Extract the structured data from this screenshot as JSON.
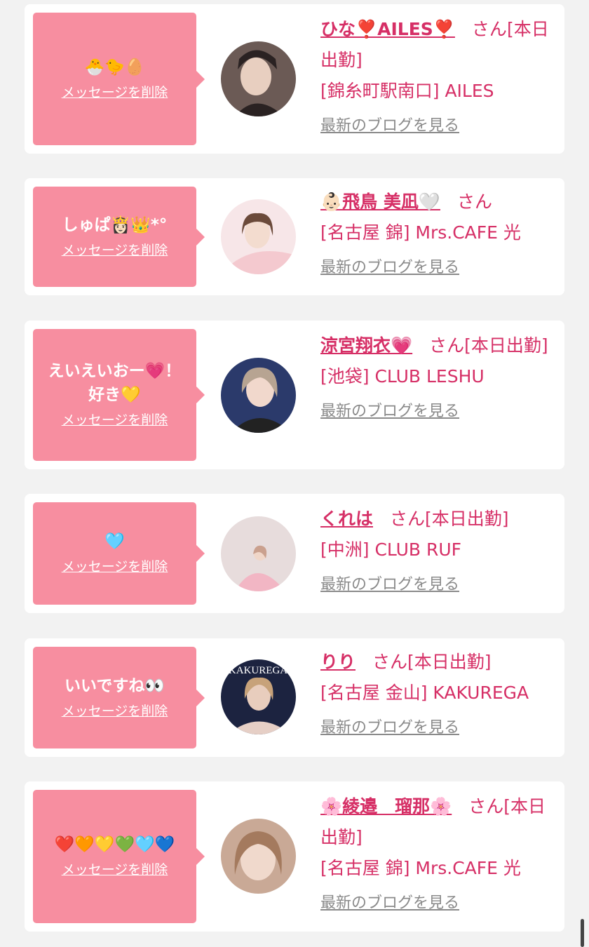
{
  "cards": [
    {
      "message": "🐣🐤🥚",
      "delete_label": "メッセージを削除",
      "name": "ひな❣️AILES❣️",
      "honorific": "さん",
      "status": "[本日出勤]",
      "shop": "[錦糸町駅南口] AILES",
      "blog_label": "最新のブログを見る",
      "avatar_colors": [
        "#6b5a55",
        "#e8cfc0",
        "#2a2222"
      ]
    },
    {
      "message": "しゅぱ👸🏻👑*°",
      "delete_label": "メッセージを削除",
      "name": "👶🏻飛鳥 美凪🤍",
      "honorific": "さん",
      "status": "",
      "shop": "[名古屋 錦] Mrs.CAFE 光",
      "blog_label": "最新のブログを見る",
      "avatar_colors": [
        "#f7e6e8",
        "#f4c9cf",
        "#6b4a3a"
      ]
    },
    {
      "message": "えいえいおー💗！\n好き💛",
      "delete_label": "メッセージを削除",
      "name": "涼宮翔衣💗",
      "honorific": "さん",
      "status": "[本日出勤]",
      "shop": "[池袋] CLUB LESHU",
      "blog_label": "最新のブログを見る",
      "avatar_colors": [
        "#2b3a6b",
        "#d9c2b0",
        "#b7a492"
      ]
    },
    {
      "message": "🩵",
      "delete_label": "メッセージを削除",
      "name": "くれは",
      "honorific": "さん",
      "status": "[本日出勤]",
      "shop": "[中洲] CLUB RUF",
      "blog_label": "最新のブログを見る",
      "avatar_colors": [
        "#e7dcdc",
        "#f2b6c4",
        "#caa08e"
      ]
    },
    {
      "message": "いいですね👀",
      "delete_label": "メッセージを削除",
      "name": "りり",
      "honorific": "さん",
      "status": "[本日出勤]",
      "shop": "[名古屋 金山] KAKUREGA",
      "blog_label": "最新のブログを見る",
      "avatar_colors": [
        "#1c2340",
        "#e8cdbd",
        "#c7a27a"
      ],
      "avatar_text": "KAKUREGA"
    },
    {
      "message": "❤️🧡💛💚🩵💙",
      "delete_label": "メッセージを削除",
      "name": "🌸綾邉　瑠那🌸",
      "honorific": "さん",
      "status": "[本日出勤]",
      "shop": "[名古屋 錦] Mrs.CAFE 光",
      "blog_label": "最新のブログを見る",
      "avatar_colors": [
        "#c9a996",
        "#f0d9cc",
        "#a47a5e"
      ]
    }
  ]
}
